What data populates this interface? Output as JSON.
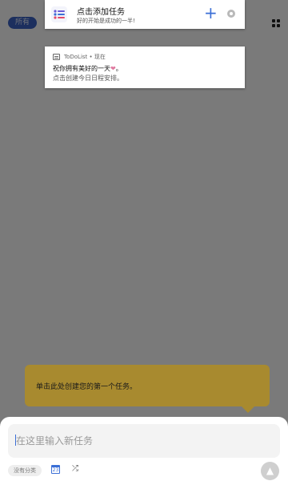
{
  "app": {
    "filter_chip": "所有"
  },
  "notification_quick_add": {
    "title": "点击添加任务",
    "subtitle": "好的开始是成功的一半!",
    "add_symbol": "+",
    "icons": {
      "app": "list-check-icon",
      "settings": "gear-icon",
      "add": "plus-icon"
    },
    "accent_color": "#3b6fd6"
  },
  "notification_greeting": {
    "meta": "ToDoList • 现在",
    "line1": "祝你拥有美好的一天",
    "heart": "❤",
    "line1_suffix": "。",
    "line2": "点击创建今日日程安排。",
    "icons": {
      "app": "todolist-small-icon"
    }
  },
  "tooltip": {
    "text": "单击此处创建您的第一个任务。",
    "color": "#a88a2f"
  },
  "composer": {
    "placeholder": "在这里输入新任务",
    "category_chip": "没有分类",
    "calendar_day": "23",
    "repeat_symbol": "⤮",
    "send_symbol": "▲",
    "icons": {
      "calendar": "calendar-icon",
      "repeat": "repeat-icon",
      "send": "send-icon"
    }
  }
}
